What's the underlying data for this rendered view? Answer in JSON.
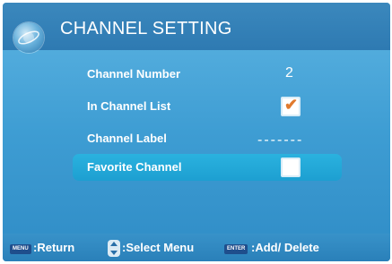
{
  "header": {
    "title": "CHANNEL SETTING",
    "logo_icon": "globe-icon"
  },
  "settings": {
    "channel_number": {
      "label": "Channel Number",
      "value": "2"
    },
    "in_channel_list": {
      "label": "In Channel List",
      "checked": true
    },
    "channel_label": {
      "label": "Channel Label",
      "value": "-------"
    },
    "favorite_channel": {
      "label": "Favorite Channel",
      "checked": false,
      "selected": true
    }
  },
  "footer": {
    "menu_key": "MENU",
    "return_text": ":Return",
    "select_icon": "up-down-arrows-icon",
    "select_text": ":Select Menu",
    "enter_key": "ENTER",
    "add_delete_text": ":Add/ Delete"
  },
  "colors": {
    "background": "#3e9dd3",
    "header": "#2e7ab2",
    "highlight": "#22a8da",
    "check_accent": "#e07a2e",
    "key_badge": "#1f4e8c"
  }
}
